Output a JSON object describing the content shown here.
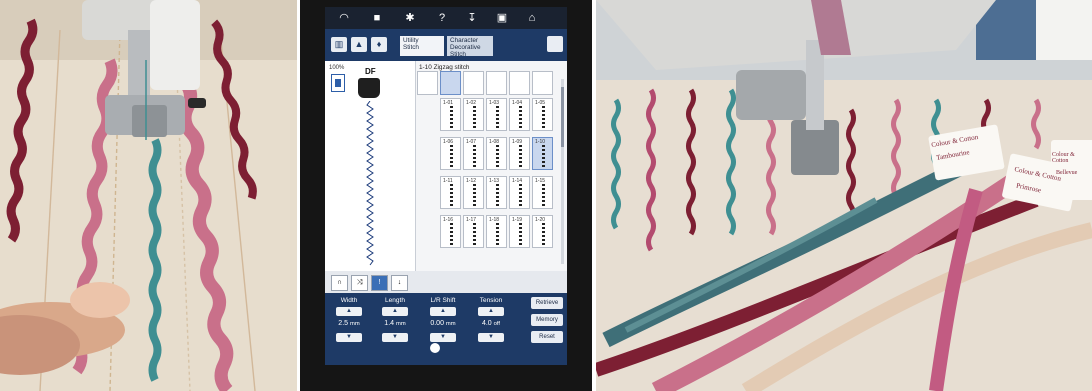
{
  "photos": [
    {
      "subject": "sewing-foot-closeup"
    },
    {
      "subject": "machine-touchscreen"
    },
    {
      "subject": "threads-and-fabric"
    }
  ],
  "screen": {
    "zoom": "100%",
    "tab_utility": "Utility\nStitch",
    "tab_decorative": "Character\nDecorative\nStitch",
    "foot_code": "DF",
    "category_title": "1-10  Zigzag stitch",
    "cells": [
      "1-01",
      "1-02",
      "1-03",
      "1-04",
      "1-05",
      "1-06",
      "1-07",
      "1-08",
      "1-09",
      "1-10",
      "1-11",
      "1-12",
      "1-13",
      "1-14",
      "1-15",
      "1-16",
      "1-17",
      "1-18",
      "1-19",
      "1-20"
    ],
    "labels": {
      "width": "Width",
      "length": "Length",
      "lr_shift": "L/R Shift",
      "tension": "Tension"
    },
    "values": {
      "width": "2.5",
      "width_unit": "mm",
      "length": "1.4",
      "length_unit": "mm",
      "lr_shift": "0.00",
      "lr_shift_unit": "mm",
      "tension": "4.0",
      "tension_unit": "off"
    },
    "buttons": {
      "retrieve": "Retrieve",
      "memory": "Memory",
      "reset": "Reset"
    }
  },
  "colors": {
    "ricrac_pink": "#c9708a",
    "ricrac_wine": "#7d1f33",
    "ricrac_teal": "#3f8f92",
    "fabric_cream": "#e9e0d2",
    "screen_blue": "#1e3a66"
  },
  "thread_cards": [
    {
      "brand": "Colour & Cotton",
      "name": "Tambourine"
    },
    {
      "brand": "Colour & Cotton",
      "name": "Primrose"
    },
    {
      "brand": "Colour & Cotton",
      "name": "Bellevue"
    }
  ]
}
